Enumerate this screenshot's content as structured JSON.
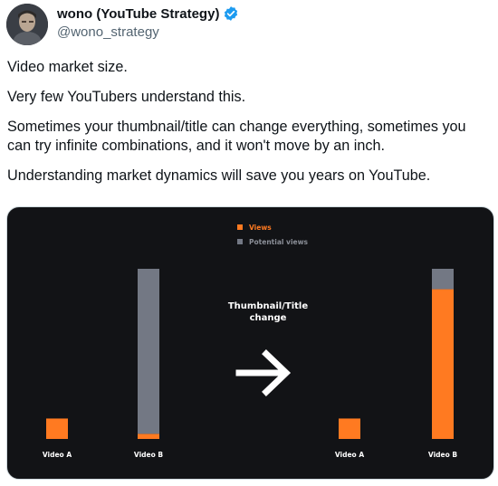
{
  "author": {
    "display_name": "wono (YouTube Strategy)",
    "handle": "@wono_strategy",
    "verified": true,
    "avatar_icon": "profile-photo",
    "verified_icon": "verified-badge-icon",
    "verified_color": "#1d9bf0"
  },
  "tweet": {
    "paragraphs": [
      "Video market size.",
      "Very few YouTubers understand this.",
      "Sometimes your thumbnail/title can change everything, sometimes you can try infinite combinations, and it won't move by an inch.",
      "Understanding market dynamics will save you years on YouTube."
    ]
  },
  "chart_data": {
    "type": "bar",
    "stacked": true,
    "legend": [
      {
        "name": "Views",
        "color": "#ff7a21"
      },
      {
        "name": "Potential views",
        "color": "#737884"
      }
    ],
    "legend_position": "top-center",
    "annotation": {
      "text": "Thumbnail/Title\nchange",
      "icon": "arrow-right-icon"
    },
    "ylim": [
      0,
      100
    ],
    "grid": false,
    "colors": {
      "background": "#121316",
      "views": "#ff7a21",
      "potential": "#737884",
      "text": "#ffffff"
    },
    "panels": [
      {
        "name": "before",
        "categories": [
          "Video A",
          "Video B"
        ],
        "series": [
          {
            "name": "Views",
            "values": [
              12,
              3
            ]
          },
          {
            "name": "Potential views",
            "values": [
              0,
              97
            ]
          }
        ]
      },
      {
        "name": "after",
        "categories": [
          "Video A",
          "Video B"
        ],
        "series": [
          {
            "name": "Views",
            "values": [
              12,
              88
            ]
          },
          {
            "name": "Potential views",
            "values": [
              0,
              12
            ]
          }
        ]
      }
    ]
  }
}
